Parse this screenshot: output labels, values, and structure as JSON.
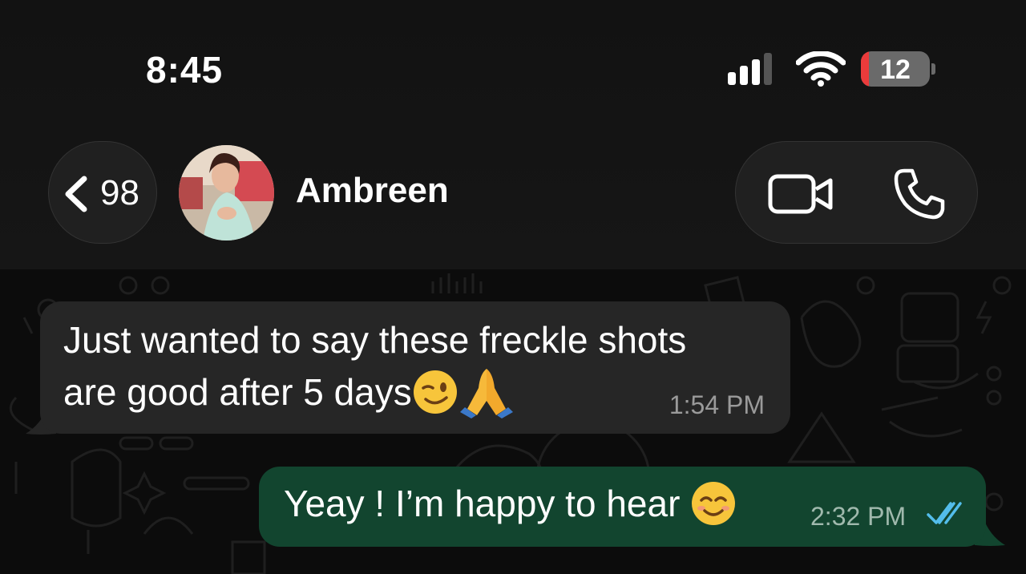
{
  "status_bar": {
    "time": "8:45",
    "battery_level": "12",
    "icons": [
      "cellular-signal-icon",
      "wifi-icon",
      "battery-icon"
    ]
  },
  "header": {
    "back_count": "98",
    "contact_name": "Ambreen",
    "actions": [
      "video-call-icon",
      "phone-call-icon"
    ]
  },
  "messages": [
    {
      "direction": "incoming",
      "text_line1": "Just wanted to say these freckle shots",
      "text_line2": "are good after 5 days",
      "emojis": [
        "winking-face-emoji",
        "folded-hands-emoji"
      ],
      "time": "1:54 PM"
    },
    {
      "direction": "outgoing",
      "text": "Yeay ! I’m happy to hear ",
      "emojis": [
        "smiling-face-emoji"
      ],
      "time": "2:32 PM",
      "status": "read-double-check-icon"
    }
  ],
  "colors": {
    "incoming_bubble": "#262626",
    "outgoing_bubble": "#12452f",
    "read_ticks": "#53bdeb",
    "battery_low": "#ea3b3b"
  }
}
